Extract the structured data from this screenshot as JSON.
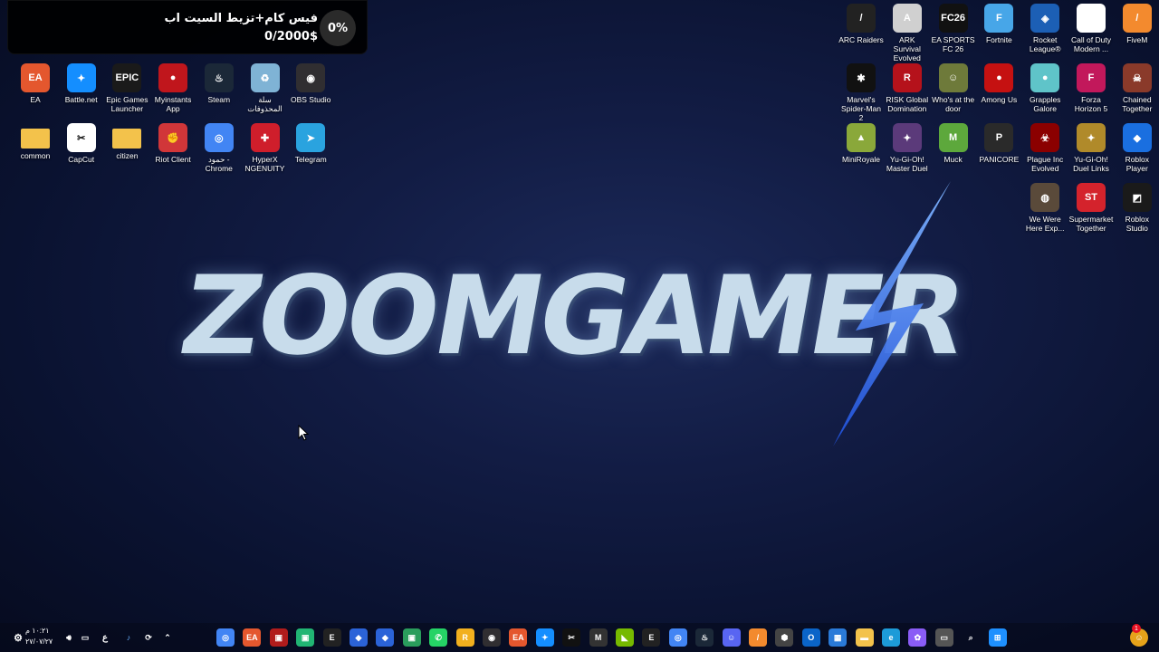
{
  "donation": {
    "percent": "0%",
    "title": "فيس كام+تزيط السيت اب",
    "amount": "0/2000$",
    "progress": 0
  },
  "wallpaper": {
    "logo_text": "ZOOMGAMER"
  },
  "left_icons": [
    {
      "label": "EA",
      "icon": "ea-icon",
      "color": "#e4572e",
      "glyph": "EA"
    },
    {
      "label": "Battle.net",
      "icon": "battlenet-icon",
      "color": "#148eff",
      "glyph": "✦"
    },
    {
      "label": "Epic Games Launcher",
      "icon": "epic-games-icon",
      "color": "#1a1a1a",
      "glyph": "EPIC"
    },
    {
      "label": "Myinstants App",
      "icon": "myinstants-icon",
      "color": "#c0161c",
      "glyph": "●"
    },
    {
      "label": "Steam",
      "icon": "steam-icon",
      "color": "#1b2838",
      "glyph": "♨"
    },
    {
      "label": "سلة المحذوفات",
      "icon": "recycle-bin-icon",
      "color": "#7fb3d5",
      "glyph": "♻"
    },
    {
      "label": "OBS Studio",
      "icon": "obs-icon",
      "color": "#302e31",
      "glyph": "◉"
    },
    {
      "label": "common",
      "icon": "folder-icon",
      "color": "#f3c24b",
      "glyph": ""
    },
    {
      "label": "CapCut",
      "icon": "capcut-icon",
      "color": "#ffffff",
      "glyph": "✂"
    },
    {
      "label": "citizen",
      "icon": "folder-icon",
      "color": "#f3c24b",
      "glyph": ""
    },
    {
      "label": "Riot Client",
      "icon": "riot-icon",
      "color": "#d13639",
      "glyph": "✊"
    },
    {
      "label": "حمود - Chrome",
      "icon": "chrome-icon",
      "color": "#4285f4",
      "glyph": "◎"
    },
    {
      "label": "HyperX NGENUITY",
      "icon": "hyperx-icon",
      "color": "#cf1e2b",
      "glyph": "✚"
    },
    {
      "label": "Telegram",
      "icon": "telegram-icon",
      "color": "#2aa3df",
      "glyph": "➤"
    }
  ],
  "right_icons": [
    {
      "label": "ARC Raiders",
      "icon": "arc-raiders-icon",
      "color": "#222222",
      "glyph": "/"
    },
    {
      "label": "ARK Survival Evolved",
      "icon": "ark-icon",
      "color": "#d0d0d0",
      "glyph": "A"
    },
    {
      "label": "EA SPORTS FC 26",
      "icon": "eafc-icon",
      "color": "#111111",
      "glyph": "FC26"
    },
    {
      "label": "Fortnite",
      "icon": "fortnite-icon",
      "color": "#47a6e8",
      "glyph": "F"
    },
    {
      "label": "Rocket League®",
      "icon": "rocket-league-icon",
      "color": "#1c5fb5",
      "glyph": "◈"
    },
    {
      "label": "Call of Duty Modern ...",
      "icon": "file-icon",
      "color": "#ffffff",
      "glyph": ""
    },
    {
      "label": "FiveM",
      "icon": "fivem-icon",
      "color": "#f38a2e",
      "glyph": "/"
    },
    {
      "label": "Marvel's Spider-Man 2",
      "icon": "spiderman-icon",
      "color": "#111111",
      "glyph": "✱"
    },
    {
      "label": "RISK Global Domination",
      "icon": "risk-icon",
      "color": "#b5121b",
      "glyph": "R"
    },
    {
      "label": "Who's at the door",
      "icon": "whos-at-door-icon",
      "color": "#6e7a3a",
      "glyph": "☺"
    },
    {
      "label": "Among Us",
      "icon": "among-us-icon",
      "color": "#c51111",
      "glyph": "●"
    },
    {
      "label": "Grapples Galore",
      "icon": "grapples-icon",
      "color": "#5fc4c9",
      "glyph": "●"
    },
    {
      "label": "Forza Horizon 5",
      "icon": "forza-icon",
      "color": "#c2185b",
      "glyph": "F"
    },
    {
      "label": "Chained Together",
      "icon": "chained-icon",
      "color": "#8a3a2a",
      "glyph": "☠"
    },
    {
      "label": "MiniRoyale",
      "icon": "miniroyale-icon",
      "color": "#8aa83a",
      "glyph": "▲"
    },
    {
      "label": "Yu-Gi-Oh! Master Duel",
      "icon": "yugioh-master-icon",
      "color": "#5b3a7a",
      "glyph": "✦"
    },
    {
      "label": "Muck",
      "icon": "muck-icon",
      "color": "#5da83c",
      "glyph": "M"
    },
    {
      "label": "PANICORE",
      "icon": "panicore-icon",
      "color": "#2a2a2a",
      "glyph": "P"
    },
    {
      "label": "Plague Inc Evolved",
      "icon": "plague-icon",
      "color": "#8b0000",
      "glyph": "☣"
    },
    {
      "label": "Yu-Gi-Oh! Duel Links",
      "icon": "yugioh-links-icon",
      "color": "#b08a2a",
      "glyph": "✦"
    },
    {
      "label": "Roblox Player",
      "icon": "roblox-icon",
      "color": "#1a6fe0",
      "glyph": "◆"
    },
    {
      "label": "We Were Here Exp...",
      "icon": "we-were-here-icon",
      "color": "#5a4a3a",
      "glyph": "◍"
    },
    {
      "label": "Supermarket Together",
      "icon": "supermarket-icon",
      "color": "#d4232c",
      "glyph": "ST"
    },
    {
      "label": "Roblox Studio",
      "icon": "roblox-studio-icon",
      "color": "#1a1a1a",
      "glyph": "◩"
    }
  ],
  "taskbar": {
    "time": "١٠:٢١ م",
    "date": "٢٧/٠٧/٢٧",
    "lang": "ع",
    "notification_count": "1",
    "apps": [
      {
        "icon": "chrome-taskbar-icon",
        "color": "#4285f4",
        "glyph": "◎"
      },
      {
        "icon": "ea-taskbar-icon",
        "color": "#e4572e",
        "glyph": "EA"
      },
      {
        "icon": "app-taskbar-icon",
        "color": "#b11c1c",
        "glyph": "▣"
      },
      {
        "icon": "app-taskbar-icon",
        "color": "#21b573",
        "glyph": "▣"
      },
      {
        "icon": "epic-taskbar-icon",
        "color": "#222222",
        "glyph": "E"
      },
      {
        "icon": "roblox-taskbar-icon",
        "color": "#2b63d8",
        "glyph": "◆"
      },
      {
        "icon": "roblox-taskbar-icon",
        "color": "#2b63d8",
        "glyph": "◆"
      },
      {
        "icon": "app-taskbar-icon",
        "color": "#2a9d5c",
        "glyph": "▣"
      },
      {
        "icon": "whatsapp-taskbar-icon",
        "color": "#25d366",
        "glyph": "✆"
      },
      {
        "icon": "rockstar-taskbar-icon",
        "color": "#f2b01e",
        "glyph": "R"
      },
      {
        "icon": "obs-taskbar-icon",
        "color": "#302e31",
        "glyph": "◉"
      },
      {
        "icon": "ea-taskbar-icon",
        "color": "#e4572e",
        "glyph": "EA"
      },
      {
        "icon": "battlenet-taskbar-icon",
        "color": "#148eff",
        "glyph": "✦"
      },
      {
        "icon": "capcut-taskbar-icon",
        "color": "#111111",
        "glyph": "✂"
      },
      {
        "icon": "app-taskbar-icon",
        "color": "#333333",
        "glyph": "M"
      },
      {
        "icon": "nvidia-taskbar-icon",
        "color": "#76b900",
        "glyph": "◣"
      },
      {
        "icon": "epic-taskbar-icon",
        "color": "#222222",
        "glyph": "E"
      },
      {
        "icon": "chrome-taskbar-icon",
        "color": "#4285f4",
        "glyph": "◎"
      },
      {
        "icon": "steam-taskbar-icon",
        "color": "#1b2838",
        "glyph": "♨"
      },
      {
        "icon": "discord-taskbar-icon",
        "color": "#5865f2",
        "glyph": "☺"
      },
      {
        "icon": "fivem-taskbar-icon",
        "color": "#f38a2e",
        "glyph": "/"
      },
      {
        "icon": "app-taskbar-icon",
        "color": "#444444",
        "glyph": "⬢"
      },
      {
        "icon": "outlook-taskbar-icon",
        "color": "#0a64c8",
        "glyph": "O"
      },
      {
        "icon": "store-taskbar-icon",
        "color": "#2a7ad8",
        "glyph": "▦"
      },
      {
        "icon": "explorer-taskbar-icon",
        "color": "#f3c24b",
        "glyph": "▬"
      },
      {
        "icon": "edge-taskbar-icon",
        "color": "#1d9bd8",
        "glyph": "e"
      },
      {
        "icon": "copilot-taskbar-icon",
        "color": "#8a5cf6",
        "glyph": "✿"
      },
      {
        "icon": "taskview-taskbar-icon",
        "color": "#555555",
        "glyph": "▭"
      },
      {
        "icon": "search-icon",
        "color": "transparent",
        "glyph": "⌕"
      },
      {
        "icon": "windows-start-icon",
        "color": "#1e90ff",
        "glyph": "⊞"
      }
    ]
  }
}
